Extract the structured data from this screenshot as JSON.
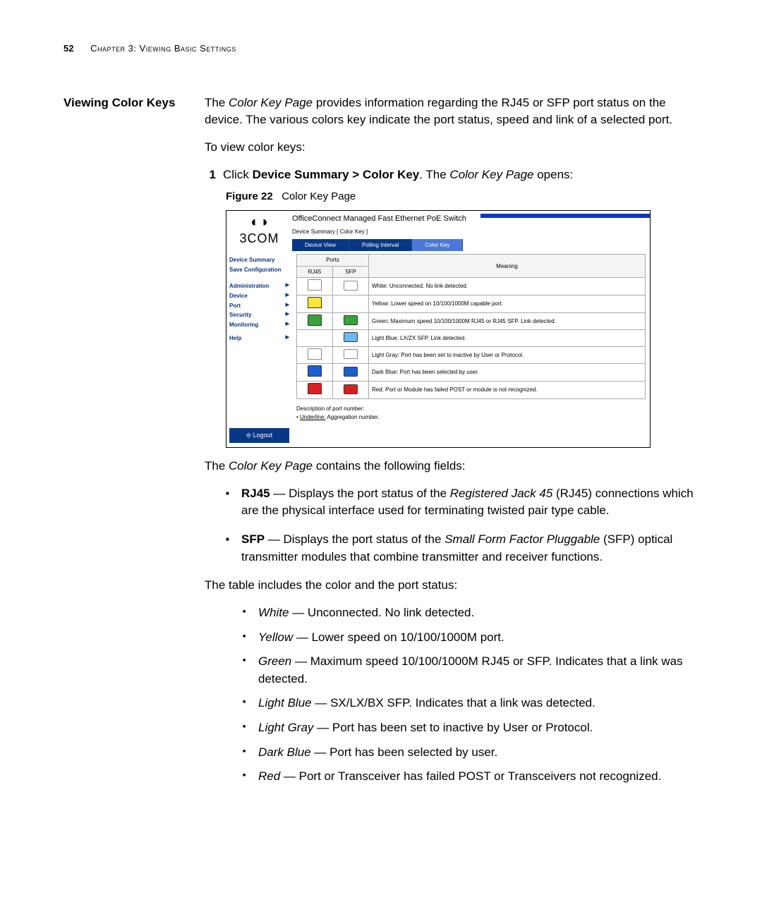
{
  "header": {
    "page_num": "52",
    "chapter": "Chapter 3: Viewing Basic Settings"
  },
  "section": {
    "side_heading": "Viewing Color Keys",
    "intro_pre": "The ",
    "intro_em": "Color Key Page",
    "intro_post": " provides information regarding the RJ45 or SFP port status on the device. The various colors key indicate the port status, speed and link of a selected port.",
    "para2": "To view color keys:",
    "step1_num": "1",
    "step1_pre": "Click ",
    "step1_bold": "Device Summary > Color Key",
    "step1_mid": ". The ",
    "step1_em": "Color Key Page",
    "step1_post": " opens:",
    "fig_label": "Figure 22",
    "fig_title": "Color Key Page"
  },
  "screenshot": {
    "logo": "3COM",
    "app_title": "OfficeConnect Managed Fast Ethernet PoE Switch",
    "breadcrumb": "Device Summary [ Color Key ]",
    "tabs": {
      "t1": "Device View",
      "t2": "Polling Interval",
      "t3": "Color Key"
    },
    "nav": {
      "n1": "Device Summary",
      "n2": "Save Configuration",
      "n3": "Administration",
      "n4": "Device",
      "n5": "Port",
      "n6": "Security",
      "n7": "Monitoring",
      "n8": "Help",
      "logout": "Logout"
    },
    "table": {
      "ports": "Ports",
      "rj45": "RJ45",
      "sfp": "SFP",
      "meaning": "Meaning",
      "rows": [
        {
          "rj45_color": "#ffffff",
          "sfp_color": "#ffffff",
          "sfp_visible": true,
          "text": "White: Unconnected. No link detected."
        },
        {
          "rj45_color": "#ffe23a",
          "sfp_color": "",
          "sfp_visible": false,
          "text": "Yellow: Lower speed on 10/100/1000M capable port."
        },
        {
          "rj45_color": "#3aa23a",
          "sfp_color": "#3aa23a",
          "sfp_visible": true,
          "text": "Green: Maximum speed 10/100/1000M RJ45 or RJ45 SFP. Link detected."
        },
        {
          "rj45_color": "",
          "sfp_color": "#6fb8f0",
          "sfp_visible": true,
          "rj45_visible": false,
          "text": "Light Blue: LX/ZX SFP. Link detected."
        },
        {
          "rj45_color": "#ffffff",
          "sfp_color": "#ffffff",
          "sfp_visible": true,
          "text": "Light Gray: Port has been set to inactive by User or Protocol."
        },
        {
          "rj45_color": "#1a5fd0",
          "sfp_color": "#1a5fd0",
          "sfp_visible": true,
          "text": "Dark Blue: Port has been selected by user."
        },
        {
          "rj45_color": "#d82020",
          "sfp_color": "#d82020",
          "sfp_visible": true,
          "text": "Red: Port or Module has failed POST or module is not recognized."
        }
      ]
    },
    "desc1": "Description of port number:",
    "desc2_pre": "• ",
    "desc2_u": "Underline:",
    "desc2_post": " Aggregation number."
  },
  "body": {
    "fields_intro_pre": "The ",
    "fields_intro_em": "Color Key Page",
    "fields_intro_post": " contains the following fields:",
    "b1_bold": "RJ45",
    "b1_pre": " — Displays the port status of the ",
    "b1_em": "Registered Jack 45",
    "b1_post": " (RJ45) connections which are the physical interface used for terminating twisted pair type cable.",
    "b2_bold": "SFP",
    "b2_pre": " — Displays the port status of the ",
    "b2_em": "Small Form Factor Pluggable",
    "b2_post": " (SFP) optical transmitter modules that combine transmitter and receiver functions.",
    "table_intro": "The table includes the color and the port status:",
    "c1_em": "White",
    "c1_txt": " — Unconnected. No link detected.",
    "c2_em": "Yellow",
    "c2_txt": " — Lower speed on 10/100/1000M port.",
    "c3_em": "Green",
    "c3_txt": " — Maximum speed 10/100/1000M RJ45 or SFP. Indicates that a link was detected.",
    "c4_em": "Light Blue",
    "c4_txt": " — SX/LX/BX SFP. Indicates that a link was detected.",
    "c5_em": "Light Gray",
    "c5_txt": " — Port has been set to inactive by User or Protocol.",
    "c6_em": "Dark Blue",
    "c6_txt": " — Port has been selected by user.",
    "c7_em": "Red",
    "c7_txt": " — Port or Transceiver has failed POST or Transceivers not recognized."
  }
}
